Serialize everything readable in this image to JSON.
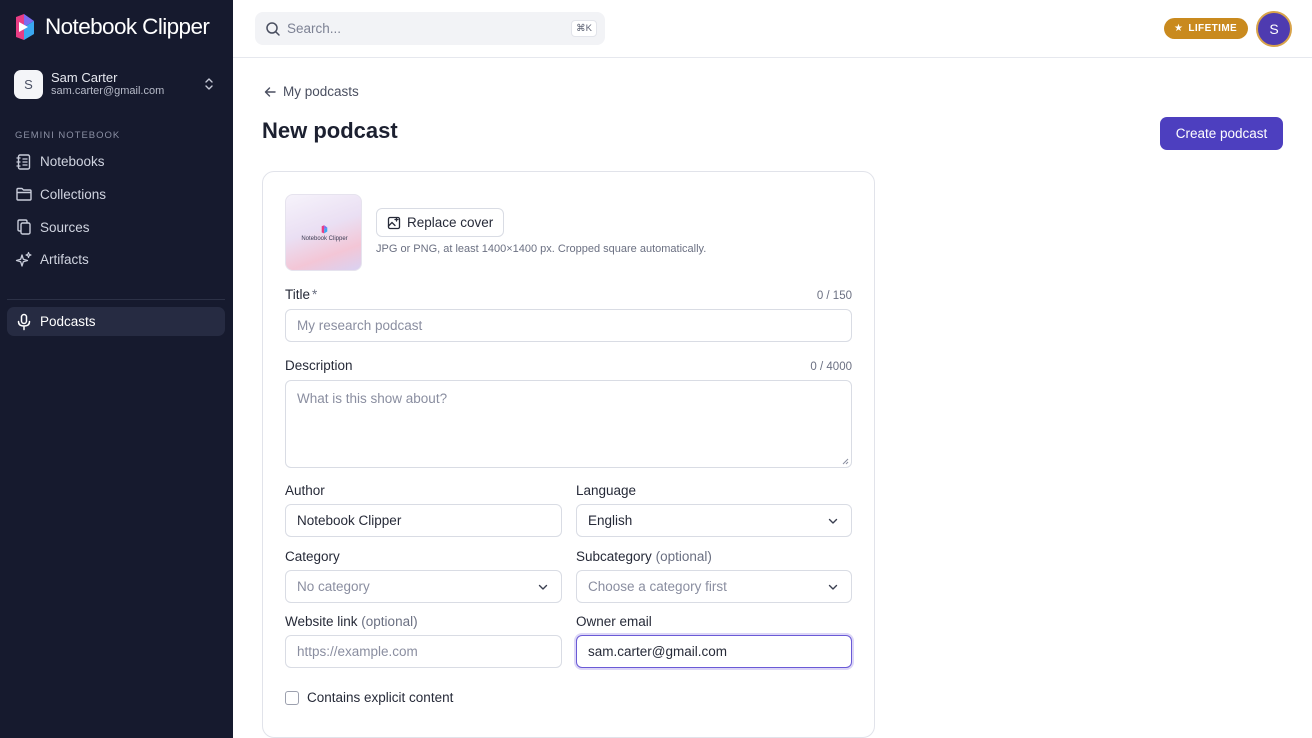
{
  "brand": {
    "name": "Notebook Clipper"
  },
  "user": {
    "initial": "S",
    "name": "Sam Carter",
    "email": "sam.carter@gmail.com"
  },
  "sidebar": {
    "section_label": "GEMINI NOTEBOOK",
    "items": [
      {
        "label": "Notebooks",
        "icon": "notebook-icon"
      },
      {
        "label": "Collections",
        "icon": "folder-icon"
      },
      {
        "label": "Sources",
        "icon": "copy-icon"
      },
      {
        "label": "Artifacts",
        "icon": "sparkles-icon"
      }
    ],
    "active_item": {
      "label": "Podcasts",
      "icon": "microphone-icon"
    }
  },
  "topbar": {
    "search_placeholder": "Search...",
    "shortcut": "⌘K",
    "badge": "LIFETIME",
    "avatar_initial": "S"
  },
  "page": {
    "back_label": "My podcasts",
    "title": "New podcast",
    "create_label": "Create podcast"
  },
  "form": {
    "cover": {
      "cover_text": "Notebook Clipper",
      "replace_label": "Replace cover",
      "hint": "JPG or PNG, at least 1400×1400 px. Cropped square automatically."
    },
    "title": {
      "label": "Title",
      "required_mark": "*",
      "counter": "0 / 150",
      "placeholder": "My research podcast"
    },
    "description": {
      "label": "Description",
      "counter": "0 / 4000",
      "placeholder": "What is this show about?"
    },
    "author": {
      "label": "Author",
      "value": "Notebook Clipper"
    },
    "language": {
      "label": "Language",
      "value": "English"
    },
    "category": {
      "label": "Category",
      "value": "No category"
    },
    "subcategory": {
      "label": "Subcategory",
      "optional": "(optional)",
      "value": "Choose a category first"
    },
    "website": {
      "label": "Website link",
      "optional": "(optional)",
      "placeholder": "https://example.com"
    },
    "owner_email": {
      "label": "Owner email",
      "value": "sam.carter@gmail.com"
    },
    "explicit": {
      "label": "Contains explicit content",
      "checked": false
    }
  },
  "colors": {
    "sidebar_bg": "#161a2e",
    "accent": "#4d3fbf",
    "badge": "#c98a1e"
  }
}
